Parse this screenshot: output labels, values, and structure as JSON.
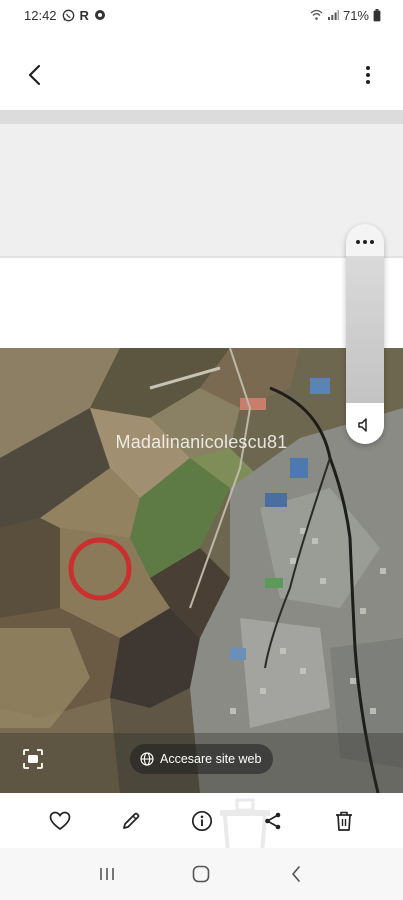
{
  "status_bar": {
    "time": "12:42",
    "letter_icon": "R",
    "battery": "71%",
    "icons": [
      "whatsapp-icon",
      "settings-icon",
      "wifi-icon",
      "signal-icon",
      "battery-icon"
    ]
  },
  "app_bar": {
    "back_icon": "back-arrow-icon",
    "more_icon": "more-vertical-icon"
  },
  "image": {
    "watermark": "Madalinanicolescu81",
    "web_chip_label": "Accesare site web",
    "web_chip_icon": "globe-icon",
    "lens_icon": "scan-text-icon"
  },
  "volume_panel": {
    "menu_icon": "more-horizontal-icon",
    "speaker_icon": "speaker-icon",
    "level": 0.22
  },
  "actions": [
    {
      "name": "favorite-button",
      "icon": "heart-icon"
    },
    {
      "name": "edit-button",
      "icon": "pencil-icon"
    },
    {
      "name": "details-button",
      "icon": "info-icon"
    },
    {
      "name": "share-button",
      "icon": "share-icon"
    },
    {
      "name": "delete-button",
      "icon": "trash-icon"
    }
  ],
  "nav": {
    "recents_icon": "recents-icon",
    "home_icon": "home-icon",
    "back_icon": "chevron-left-icon"
  }
}
